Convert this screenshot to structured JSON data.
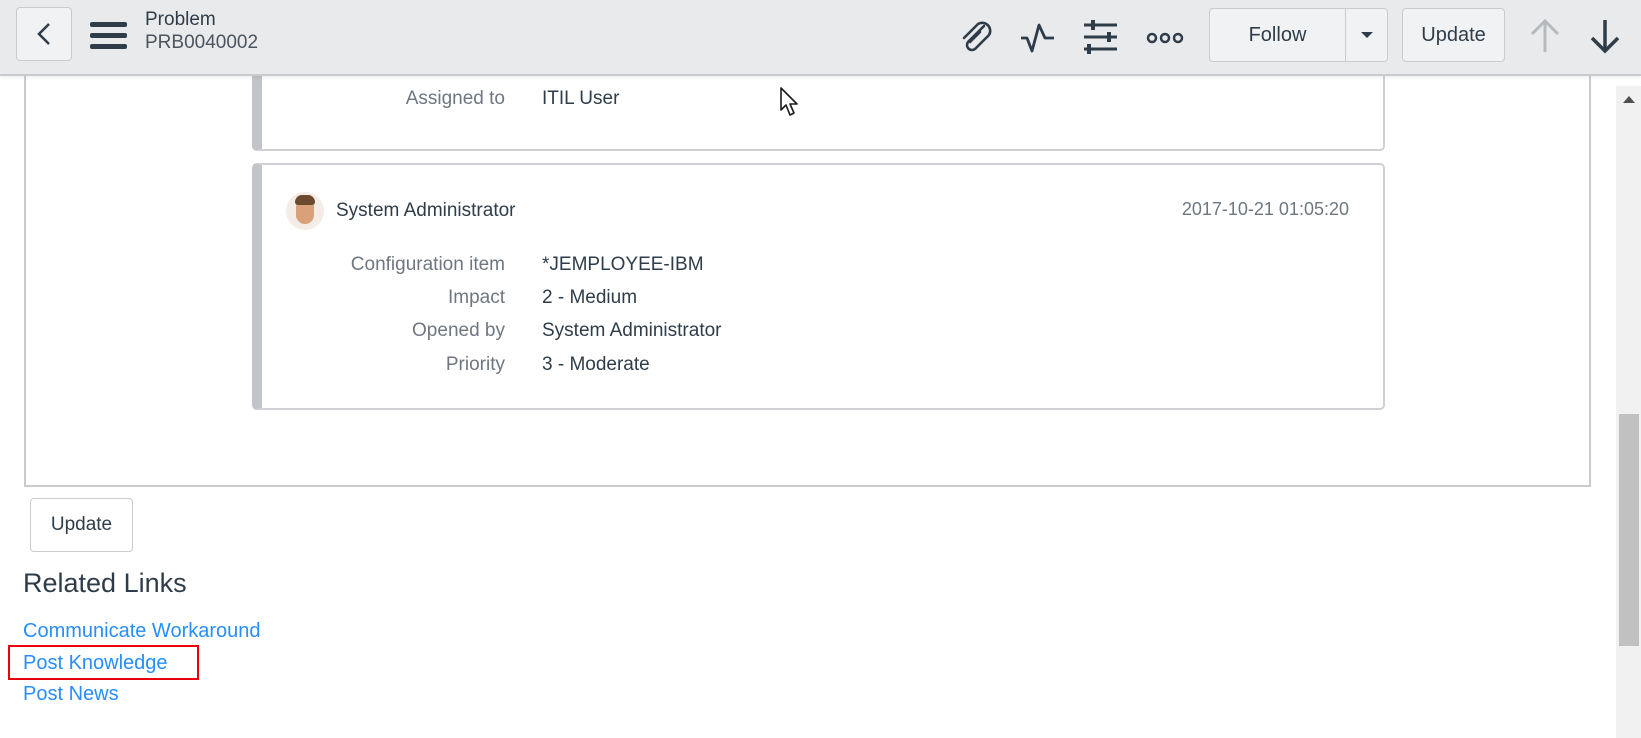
{
  "header": {
    "back_icon": "chevron-left-icon",
    "menu_icon": "hamburger-menu-icon",
    "record_type": "Problem",
    "record_number": "PRB0040002",
    "icons": [
      "paperclip-icon",
      "activity-pulse-icon",
      "sliders-icon",
      "more-dots-icon"
    ],
    "follow_label": "Follow",
    "follow_dropdown_icon": "caret-down-icon",
    "update_label": "Update",
    "prev_record_icon": "arrow-up-icon",
    "next_record_icon": "arrow-down-icon",
    "prev_enabled": false,
    "next_enabled": true
  },
  "activity": {
    "entries": [
      {
        "fields": [
          {
            "label": "Assigned to",
            "value": "ITIL User"
          }
        ]
      },
      {
        "author": "System Administrator",
        "timestamp": "2017-10-21 01:05:20",
        "fields": [
          {
            "label": "Configuration item",
            "value": "*JEMPLOYEE-IBM"
          },
          {
            "label": "Impact",
            "value": "2 - Medium"
          },
          {
            "label": "Opened by",
            "value": "System Administrator"
          },
          {
            "label": "Priority",
            "value": "3 - Moderate"
          }
        ]
      }
    ]
  },
  "footer": {
    "update_label": "Update"
  },
  "related_links": {
    "heading": "Related Links",
    "links": [
      {
        "label": "Communicate Workaround"
      },
      {
        "label": "Post Knowledge",
        "highlighted": true
      },
      {
        "label": "Post News"
      }
    ]
  },
  "colors": {
    "link": "#278efc",
    "highlight": "#e8000d",
    "header_bg": "#e9eaec"
  }
}
